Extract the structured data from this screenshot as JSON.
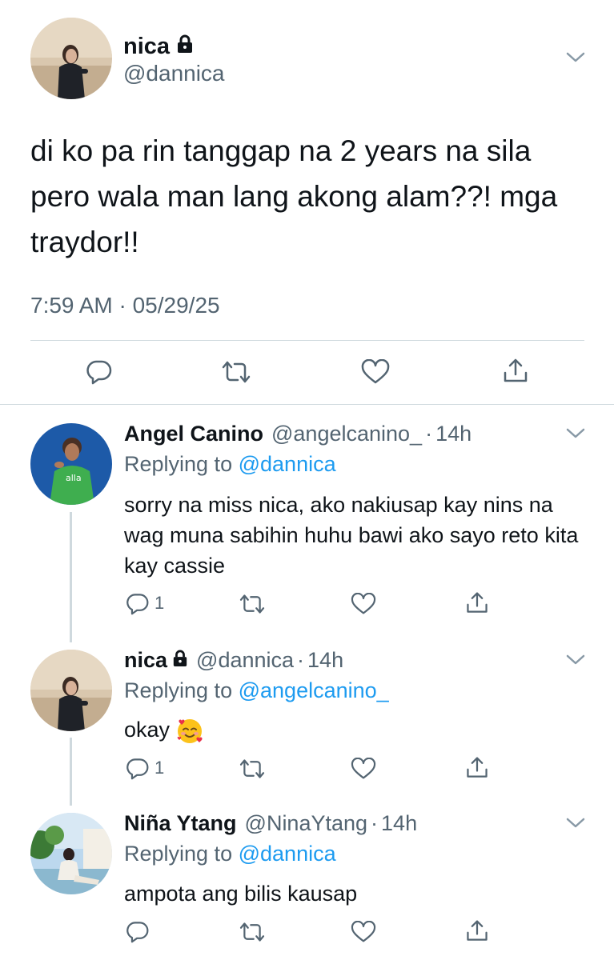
{
  "main_tweet": {
    "name": "nica",
    "handle": "@dannica",
    "text": "di ko pa rin tanggap na 2 years na sila pero wala man lang akong alam??! mga traydor!!",
    "timestamp": "7:59 AM · 05/29/25",
    "icons": [
      "lock-icon",
      "chevron-down-icon",
      "reply-icon",
      "retweet-icon",
      "like-icon",
      "share-icon"
    ]
  },
  "replies": [
    {
      "name": "Angel Canino",
      "handle": "@angelcanino_",
      "dot": "·",
      "time": "14h",
      "replying_prefix": "Replying to",
      "replying_to": "@dannica",
      "text": "sorry na miss nica, ako nakiusap kay nins na wag muna sabihin huhu bawi ako sayo reto kita kay cassie",
      "reply_count": "1"
    },
    {
      "name": "nica",
      "handle": "@dannica",
      "dot": "·",
      "time": "14h",
      "replying_prefix": "Replying to",
      "replying_to": "@angelcanino_",
      "text": "okay",
      "emoji": "smiling-face-with-hearts-icon",
      "reply_count": "1"
    },
    {
      "name": "Niña Ytang",
      "handle": "@NinaYtang",
      "dot": "·",
      "time": "14h",
      "replying_prefix": "Replying to",
      "replying_to": "@dannica",
      "text": "ampota ang bilis kausap",
      "reply_count": ""
    }
  ],
  "colors": {
    "text": "#0f1419",
    "secondary": "#536471",
    "link": "#1d9bf0",
    "divider": "#cfd9de"
  }
}
